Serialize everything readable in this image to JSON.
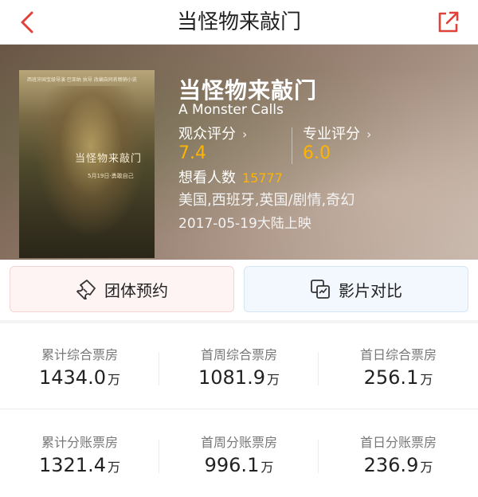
{
  "nav": {
    "title": "当怪物来敲门",
    "back_icon": "back-arrow-icon",
    "share_icon": "share-icon",
    "accent_color": "#e0423a"
  },
  "movie": {
    "title": "当怪物来敲门",
    "english_title": "A Monster Calls",
    "poster": {
      "title_text": "当怪物来敲门",
      "date_text": "5月19日·勇敢自己",
      "tagline": "西班牙国宝级导演 巴亚纳 执导 改编自同名畅销小说"
    },
    "audience_score": {
      "label": "观众评分",
      "value": "7.4"
    },
    "pro_score": {
      "label": "专业评分",
      "value": "6.0"
    },
    "want_to_see": {
      "label": "想看人数",
      "value": "15777"
    },
    "genre": "美国,西班牙,英国/剧情,奇幻",
    "release": "2017-05-19大陆上映",
    "score_color": "#ffb400"
  },
  "actions": {
    "group_booking": {
      "label": "团体预约",
      "icon": "ticket-icon"
    },
    "film_compare": {
      "label": "影片对比",
      "icon": "compare-icon"
    }
  },
  "stats": {
    "row1": [
      {
        "label": "累计综合票房",
        "value": "1434.0",
        "unit": "万"
      },
      {
        "label": "首周综合票房",
        "value": "1081.9",
        "unit": "万"
      },
      {
        "label": "首日综合票房",
        "value": "256.1",
        "unit": "万"
      }
    ],
    "row2": [
      {
        "label": "累计分账票房",
        "value": "1321.4",
        "unit": "万"
      },
      {
        "label": "首周分账票房",
        "value": "996.1",
        "unit": "万"
      },
      {
        "label": "首日分账票房",
        "value": "236.9",
        "unit": "万"
      }
    ]
  }
}
